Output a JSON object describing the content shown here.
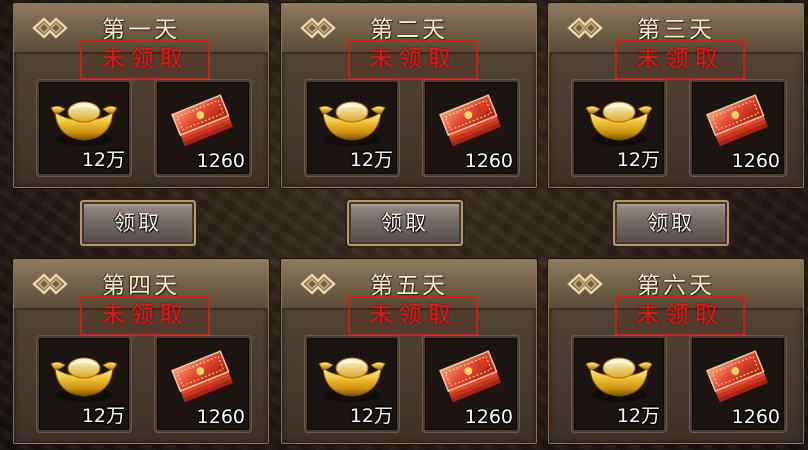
{
  "status_label": "未领取",
  "claim_label": "领取",
  "days": [
    {
      "title": "第一天",
      "gold_qty": "12万",
      "voucher_qty": "1260"
    },
    {
      "title": "第二天",
      "gold_qty": "12万",
      "voucher_qty": "1260"
    },
    {
      "title": "第三天",
      "gold_qty": "12万",
      "voucher_qty": "1260"
    },
    {
      "title": "第四天",
      "gold_qty": "12万",
      "voucher_qty": "1260"
    },
    {
      "title": "第五天",
      "gold_qty": "12万",
      "voucher_qty": "1260"
    },
    {
      "title": "第六天",
      "gold_qty": "12万",
      "voucher_qty": "1260"
    }
  ],
  "colors": {
    "stamp_red": "#e11a14",
    "header_gold": "#8e7b5f",
    "button_border": "#b59862"
  },
  "icons": [
    "diamond-icon",
    "gold-ingot-icon",
    "voucher-stack-icon"
  ]
}
